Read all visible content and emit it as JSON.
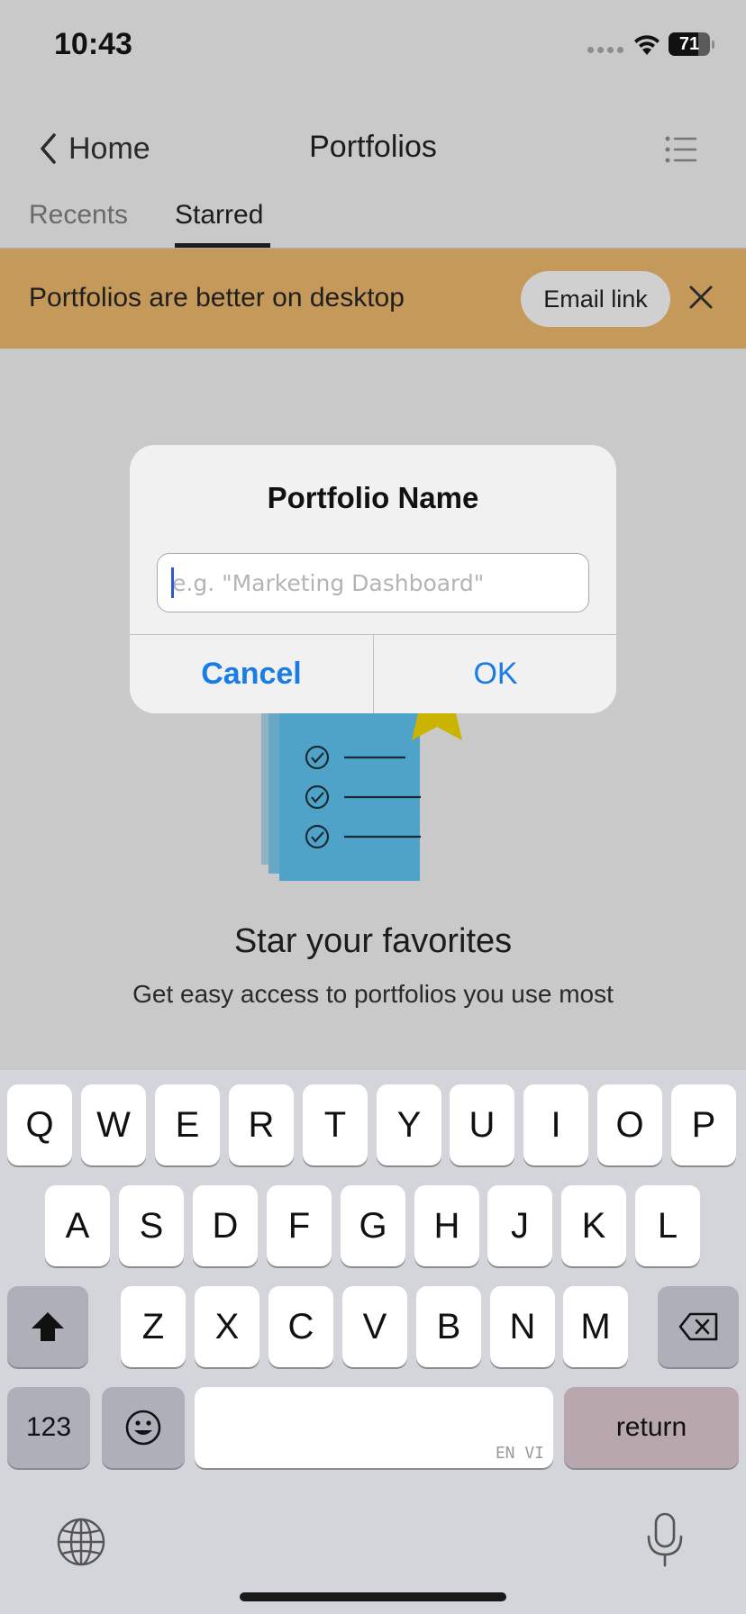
{
  "status_bar": {
    "time": "10:43",
    "battery_percent": "71",
    "battery_level": 0.71
  },
  "nav": {
    "back_label": "Home",
    "title": "Portfolios",
    "right_icon": "list-icon"
  },
  "tabs": [
    {
      "label": "Recents",
      "selected": false
    },
    {
      "label": "Starred",
      "selected": true
    }
  ],
  "banner": {
    "text": "Portfolios are better on desktop",
    "button_label": "Email link",
    "close_icon": "close-icon",
    "color": "#c4995a"
  },
  "empty_state": {
    "title": "Star your favorites",
    "subtitle": "Get easy access to portfolios you use most"
  },
  "dialog": {
    "title": "Portfolio Name",
    "input_value": "",
    "input_placeholder": "e.g. \"Marketing Dashboard\"",
    "cancel_label": "Cancel",
    "ok_label": "OK",
    "button_color": "#1a7de6"
  },
  "keyboard": {
    "rows": [
      [
        "Q",
        "W",
        "E",
        "R",
        "T",
        "Y",
        "U",
        "I",
        "O",
        "P"
      ],
      [
        "A",
        "S",
        "D",
        "F",
        "G",
        "H",
        "J",
        "K",
        "L"
      ],
      [
        "Z",
        "X",
        "C",
        "V",
        "B",
        "N",
        "M"
      ]
    ],
    "numbers_label": "123",
    "return_label": "return",
    "space_hint": "EN VI",
    "shift_icon": "shift-icon",
    "delete_icon": "delete-icon",
    "emoji_icon": "emoji-icon",
    "globe_icon": "globe-icon",
    "mic_icon": "microphone-icon"
  }
}
